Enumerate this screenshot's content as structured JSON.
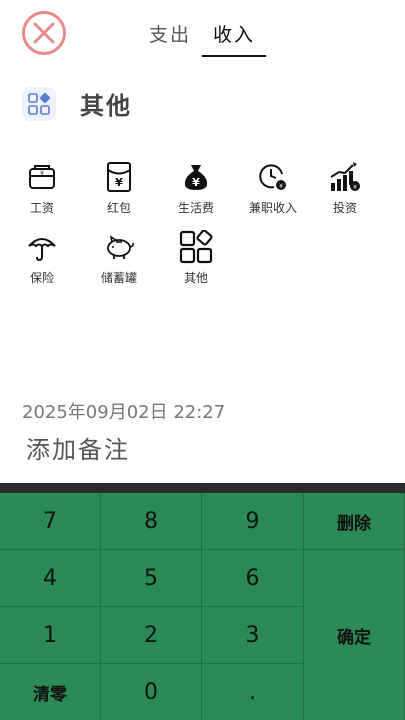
{
  "header": {
    "close_icon": "close-icon",
    "tabs": [
      {
        "label": "支出",
        "active": false
      },
      {
        "label": "收入",
        "active": true
      }
    ]
  },
  "selected_category": {
    "icon": "other-grid-icon",
    "label": "其他"
  },
  "categories": [
    {
      "label": "工资",
      "icon": "wallet-icon"
    },
    {
      "label": "红包",
      "icon": "red-envelope-icon"
    },
    {
      "label": "生活费",
      "icon": "money-bag-icon"
    },
    {
      "label": "兼职收入",
      "icon": "clock-coin-icon"
    },
    {
      "label": "投资",
      "icon": "invest-chart-icon"
    },
    {
      "label": "保险",
      "icon": "umbrella-icon"
    },
    {
      "label": "储蓄罐",
      "icon": "piggy-bank-icon"
    },
    {
      "label": "其他",
      "icon": "other-grid-icon"
    }
  ],
  "entry": {
    "datetime": "2025年09月02日 22:27",
    "note_placeholder": "添加备注"
  },
  "keypad": {
    "k7": "7",
    "k8": "8",
    "k9": "9",
    "delete": "删除",
    "k4": "4",
    "k5": "5",
    "k6": "6",
    "k1": "1",
    "k2": "2",
    "k3": "3",
    "confirm": "确定",
    "clear": "清零",
    "k0": "0",
    "dot": "."
  },
  "colors": {
    "keypad_bg": "#2c8a55",
    "close_accent": "#e88a8a"
  }
}
